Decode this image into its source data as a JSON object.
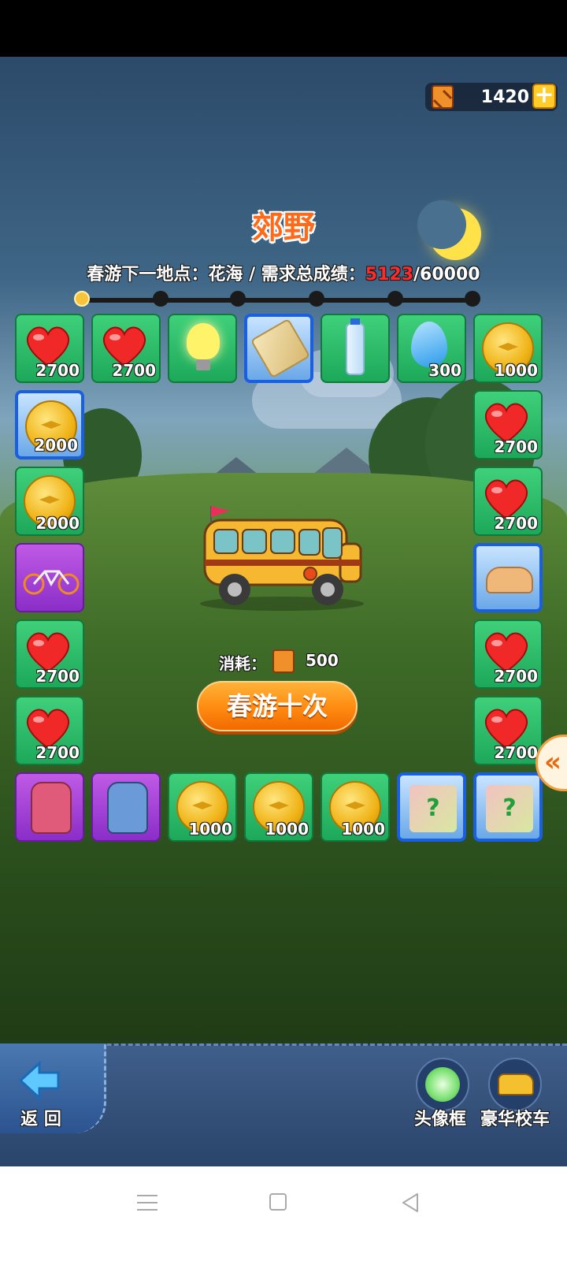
{
  "header": {
    "fuel_count": "1420",
    "plus_symbol": "+"
  },
  "location": {
    "title": "郊野",
    "goal_prefix": "春游下一地点：花海 / 需求总成绩：",
    "current_score": "5123",
    "goal_separator": "/",
    "target_score": "60000",
    "progress_nodes": 6,
    "active_node": 1
  },
  "tiles": {
    "top": [
      {
        "item": "heart-icon",
        "value": "2700"
      },
      {
        "item": "heart-icon",
        "value": "2700"
      },
      {
        "item": "bulb-icon",
        "value": ""
      },
      {
        "item": "diploma-icon",
        "value": ""
      },
      {
        "item": "water-bottle-icon",
        "value": ""
      },
      {
        "item": "water-drop-icon",
        "value": "300"
      },
      {
        "item": "coin-icon",
        "value": "1000"
      }
    ],
    "left": [
      {
        "item": "coin-icon",
        "value": "2000"
      },
      {
        "item": "coin-icon",
        "value": "2000"
      },
      {
        "item": "bicycle-icon",
        "value": ""
      },
      {
        "item": "heart-icon",
        "value": "2700"
      },
      {
        "item": "heart-icon",
        "value": "2700"
      }
    ],
    "right": [
      {
        "item": "heart-icon",
        "value": "2700"
      },
      {
        "item": "heart-icon",
        "value": "2700"
      },
      {
        "item": "scooter-icon",
        "value": ""
      },
      {
        "item": "heart-icon",
        "value": "2700"
      },
      {
        "item": "heart-icon",
        "value": "2700"
      }
    ],
    "bottom": [
      {
        "item": "backpack-icon",
        "value": ""
      },
      {
        "item": "backpack-icon",
        "value": ""
      },
      {
        "item": "coin-icon",
        "value": "1000"
      },
      {
        "item": "coin-icon",
        "value": "1000"
      },
      {
        "item": "coin-icon",
        "value": "1000"
      },
      {
        "item": "mystery-box-icon",
        "value": "?"
      },
      {
        "item": "mystery-box-icon",
        "value": "?"
      }
    ]
  },
  "action": {
    "cost_label": "消耗：",
    "cost_value": "500",
    "trip_button": "春游十次",
    "collapse_symbol": "«"
  },
  "bottom_bar": {
    "back_label": "返 回",
    "avatar_frame_label": "头像框",
    "luxury_bus_label": "豪华校车"
  },
  "colors": {
    "tile_green": "#1da85a",
    "tile_blue_border": "#1a5fe0",
    "tile_purple": "#8a2ec8",
    "title_orange": "#ff6a1a",
    "score_red": "#ff2a2a",
    "button_orange": "#ff8a10"
  }
}
